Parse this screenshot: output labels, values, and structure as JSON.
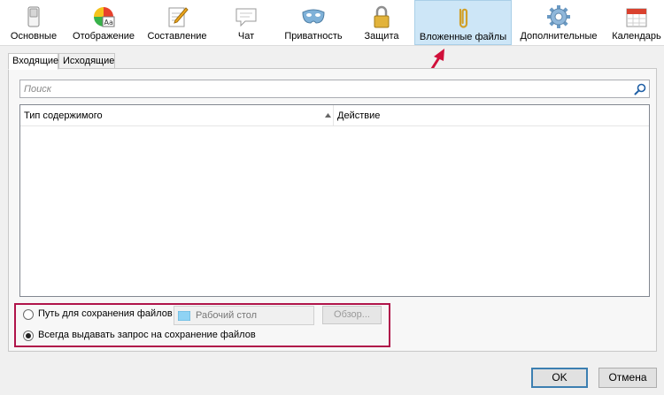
{
  "toolbar": {
    "items": [
      {
        "label": "Основные",
        "icon": "switch-icon"
      },
      {
        "label": "Отображение",
        "icon": "palette-icon"
      },
      {
        "label": "Составление",
        "icon": "pencil-note-icon"
      },
      {
        "label": "Чат",
        "icon": "chat-bubble-icon"
      },
      {
        "label": "Приватность",
        "icon": "mask-icon"
      },
      {
        "label": "Защита",
        "icon": "padlock-icon"
      },
      {
        "label": "Вложенные файлы",
        "icon": "paperclip-icon",
        "active": true
      },
      {
        "label": "Дополнительные",
        "icon": "gear-icon"
      },
      {
        "label": "Календарь",
        "icon": "calendar-icon"
      }
    ]
  },
  "tabs": {
    "incoming": "Входящие",
    "outgoing": "Исходящие"
  },
  "search": {
    "placeholder": "Поиск"
  },
  "list": {
    "columns": [
      "Тип содержимого",
      "Действие"
    ]
  },
  "save": {
    "path_label": "Путь для сохранения файлов",
    "path_value": "Рабочий стол",
    "browse_label": "Обзор...",
    "ask_label": "Всегда выдавать запрос на сохранение файлов",
    "selected": "ask"
  },
  "dialog": {
    "ok_label": "OK",
    "cancel_label": "Отмена"
  },
  "colors": {
    "active_tab_bg": "#cde6f7",
    "highlight_border": "#b0144a",
    "arrow": "#d0103a",
    "ok_border": "#3c7fb1"
  }
}
